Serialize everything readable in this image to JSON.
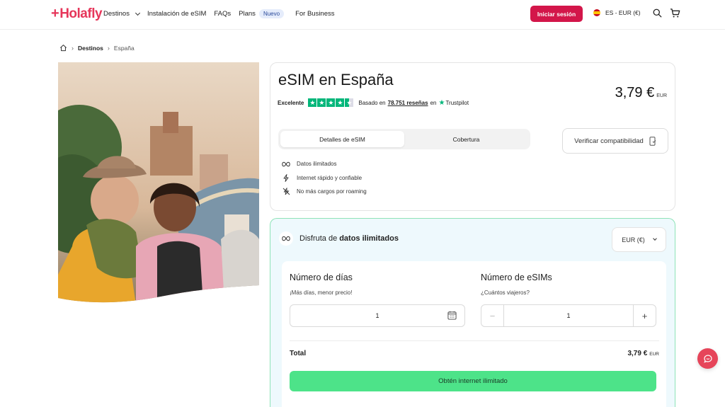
{
  "header": {
    "logo": "Holafly",
    "nav": [
      {
        "label": "Destinos"
      },
      {
        "label": "Instalación de eSIM"
      },
      {
        "label": "FAQs"
      },
      {
        "label": "Plans"
      }
    ],
    "plans_badge": "Nuevo",
    "for_business": "For Business",
    "login": "Iniciar sesión",
    "language": "ES - EUR (€)"
  },
  "breadcrumb": {
    "items": [
      "Destinos",
      "España"
    ]
  },
  "product": {
    "title": "eSIM en España",
    "price": "3,79 €",
    "price_currency": "EUR",
    "rating_label": "Excelente",
    "rating_stars": 4.5,
    "based_on": "Basado en",
    "reviews": "78.751 reseñas",
    "on": "en",
    "trustpilot": "Trustpilot",
    "tabs": [
      {
        "label": "Detalles de eSIM",
        "active": true
      },
      {
        "label": "Cobertura",
        "active": false
      }
    ],
    "compat_button": "Verificar compatibilidad",
    "features": [
      {
        "icon": "infinity-icon",
        "label": "Datos ilimitados"
      },
      {
        "icon": "lightning-icon",
        "label": "Internet rápido y confiable"
      },
      {
        "icon": "no-roaming-icon",
        "label": "No más cargos por roaming"
      }
    ]
  },
  "plan": {
    "heading_prefix": "Disfruta de",
    "heading_bold": "datos ilimitados",
    "currency": "EUR (€)",
    "days_title": "Número de días",
    "days_sub": "¡Más días, menor precio!",
    "days_value": "1",
    "esims_title": "Número de eSIMs",
    "esims_sub": "¿Cuántos viajeros?",
    "esims_value": "1",
    "total_label": "Total",
    "total_price": "3,79 €",
    "total_currency": "EUR",
    "cta": "Obtén internet ilimitado"
  },
  "colors": {
    "brand": "#e6365a",
    "login_bg": "#d3164a",
    "trustpilot_green": "#00b67a",
    "cta_green": "#4de389"
  }
}
